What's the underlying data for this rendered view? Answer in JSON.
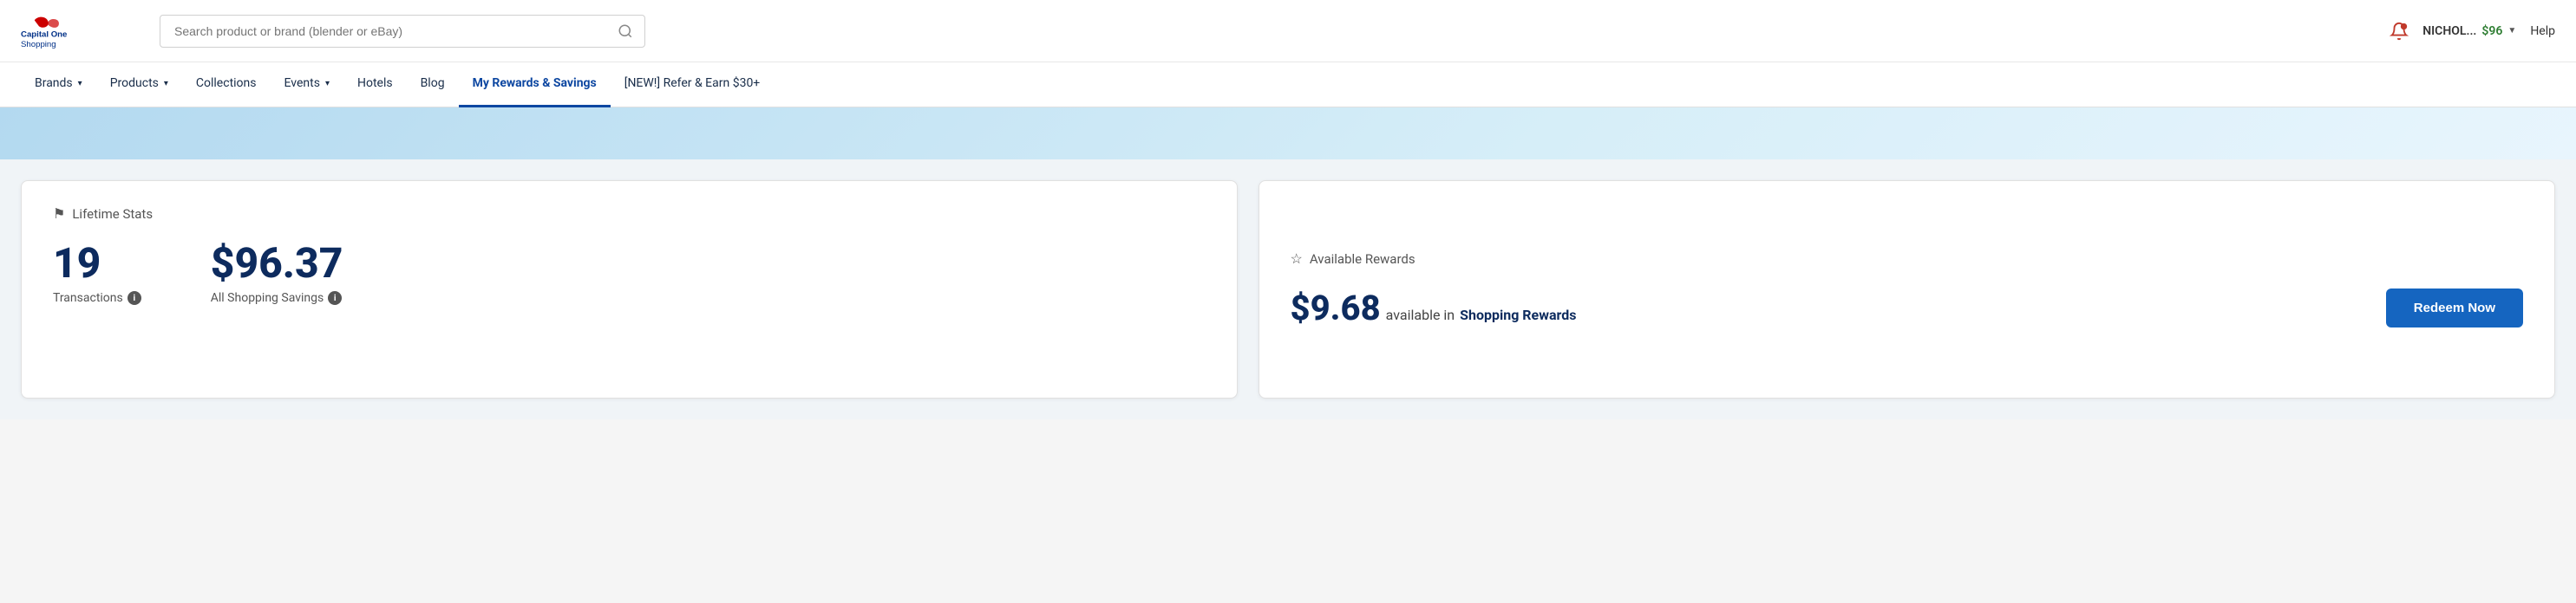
{
  "header": {
    "logo_alt": "Capital One Shopping",
    "search_placeholder": "Search product or brand (blender or eBay)",
    "user_name": "NICHOL...",
    "user_amount": "$96",
    "help_label": "Help"
  },
  "nav": {
    "items": [
      {
        "label": "Brands",
        "has_caret": true,
        "active": false,
        "id": "brands"
      },
      {
        "label": "Products",
        "has_caret": true,
        "active": false,
        "id": "products"
      },
      {
        "label": "Collections",
        "has_caret": false,
        "active": false,
        "id": "collections"
      },
      {
        "label": "Events",
        "has_caret": true,
        "active": false,
        "id": "events"
      },
      {
        "label": "Hotels",
        "has_caret": false,
        "active": false,
        "id": "hotels"
      },
      {
        "label": "Blog",
        "has_caret": false,
        "active": false,
        "id": "blog"
      },
      {
        "label": "My Rewards & Savings",
        "has_caret": false,
        "active": true,
        "id": "rewards"
      },
      {
        "label": "[NEW!] Refer & Earn $30+",
        "has_caret": false,
        "active": false,
        "id": "refer"
      }
    ]
  },
  "lifetime_stats": {
    "card_header": "Lifetime Stats",
    "flag_icon": "🏳",
    "transactions_value": "19",
    "transactions_label": "Transactions",
    "savings_value": "$96.37",
    "savings_label": "All Shopping Savings"
  },
  "available_rewards": {
    "card_header": "Available Rewards",
    "star_icon": "☆",
    "amount": "$9.68",
    "available_text": "available in",
    "reward_type": "Shopping Rewards",
    "redeem_label": "Redeem Now"
  }
}
